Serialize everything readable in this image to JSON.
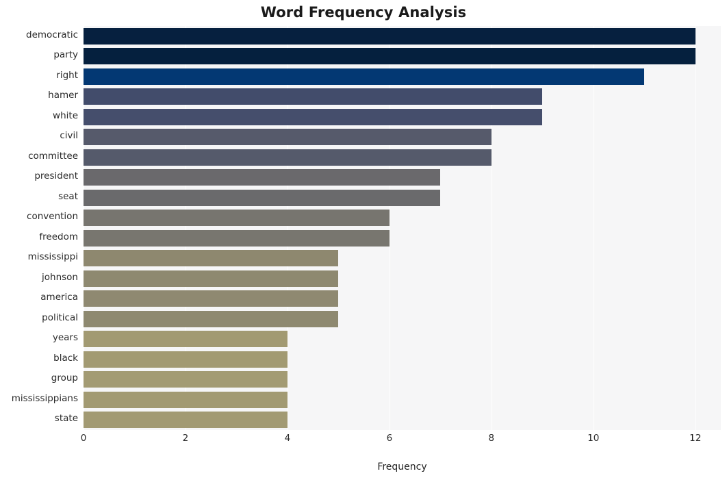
{
  "chart_data": {
    "type": "bar",
    "orientation": "horizontal",
    "title": "Word Frequency Analysis",
    "xlabel": "Frequency",
    "ylabel": "",
    "xlim": [
      0,
      12.5
    ],
    "xticks": [
      0,
      2,
      4,
      6,
      8,
      10,
      12
    ],
    "xtick_labels": [
      "0",
      "2",
      "4",
      "6",
      "8",
      "10",
      "12"
    ],
    "grid": "vertical",
    "legend": "none",
    "categories": [
      "democratic",
      "party",
      "right",
      "hamer",
      "white",
      "civil",
      "committee",
      "president",
      "seat",
      "convention",
      "freedom",
      "mississippi",
      "johnson",
      "america",
      "political",
      "years",
      "black",
      "group",
      "mississippians",
      "state"
    ],
    "values": [
      12,
      12,
      11,
      9,
      9,
      8,
      8,
      7,
      7,
      6,
      6,
      5,
      5,
      5,
      5,
      4,
      4,
      4,
      4,
      4
    ],
    "bar_colors": [
      "#06203f",
      "#05203e",
      "#033873",
      "#424c6b",
      "#454e6c",
      "#565a6b",
      "#555a6b",
      "#6a696c",
      "#6a6a6c",
      "#77756f",
      "#78766f",
      "#8e886f",
      "#8e8970",
      "#8f8971",
      "#8e8970",
      "#a29a72",
      "#a29a72",
      "#a39b73",
      "#a29a72",
      "#a29a73"
    ],
    "plot_background": "#f6f6f7",
    "figure_background": "#ffffff",
    "gridline_color": "#ffffff",
    "title_color": "#1a1a1a",
    "tick_color": "#2a2a2a"
  }
}
